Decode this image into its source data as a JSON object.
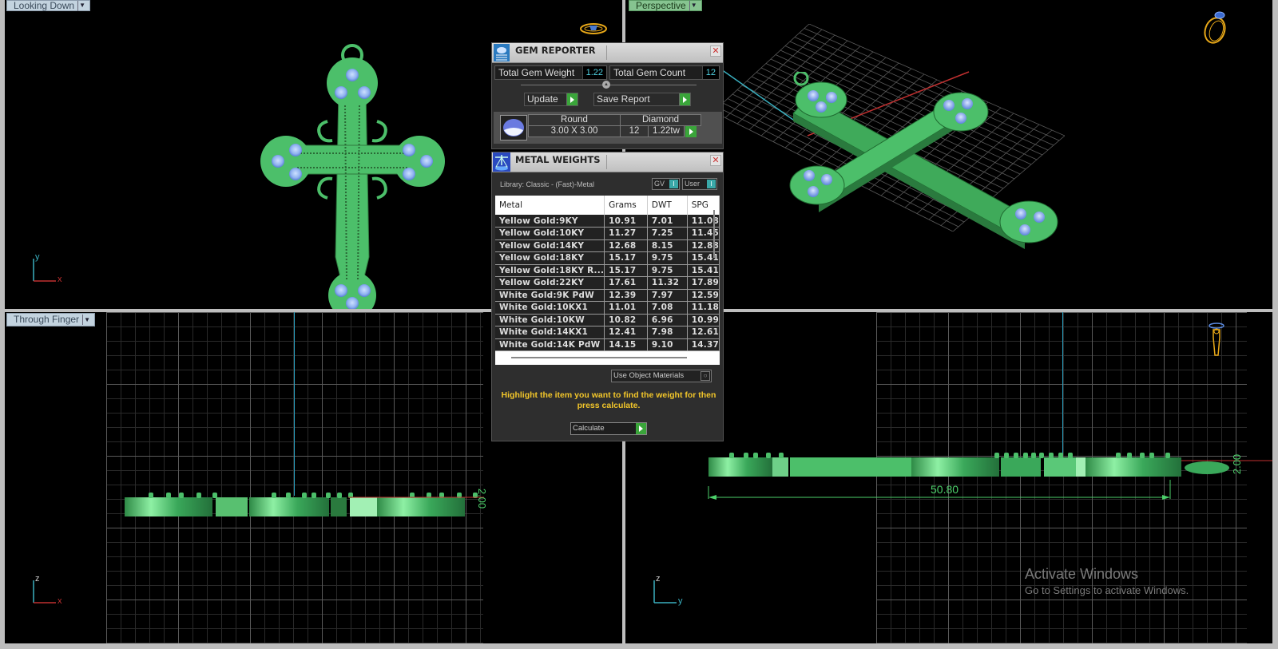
{
  "viewports": {
    "top_left": {
      "label": "Looking Down",
      "axis_v": "y",
      "axis_h": "x"
    },
    "top_right": {
      "label": "Perspective"
    },
    "bottom_left": {
      "label": "Through Finger",
      "axis_v": "z",
      "axis_h": "x",
      "dimension": "2.00"
    },
    "bottom_right": {
      "axis_v": "z",
      "axis_h": "y",
      "dimension_length": "50.80",
      "dimension_height": "2.00"
    }
  },
  "gem_reporter": {
    "title": "GEM REPORTER",
    "total_gem_weight_label": "Total Gem Weight",
    "total_gem_weight": "1.22",
    "total_gem_count_label": "Total Gem Count",
    "total_gem_count": "12",
    "update_label": "Update",
    "save_report_label": "Save Report",
    "gem": {
      "shape": "Round",
      "type": "Diamond",
      "size": "3.00 X 3.00",
      "count": "12",
      "weight": "1.22tw"
    }
  },
  "metal_weights": {
    "title": "METAL WEIGHTS",
    "library": "Library: Classic - (Fast)-Metal",
    "toggle_gv": "GV",
    "toggle_user": "User",
    "columns": [
      "Metal",
      "Grams",
      "DWT",
      "SPG"
    ],
    "rows": [
      {
        "metal": "Yellow Gold:9KY",
        "grams": "10.91",
        "dwt": "7.01",
        "spg": "11.08"
      },
      {
        "metal": "Yellow Gold:10KY",
        "grams": "11.27",
        "dwt": "7.25",
        "spg": "11.45"
      },
      {
        "metal": "Yellow Gold:14KY",
        "grams": "12.68",
        "dwt": "8.15",
        "spg": "12.88"
      },
      {
        "metal": "Yellow Gold:18KY",
        "grams": "15.17",
        "dwt": "9.75",
        "spg": "15.41"
      },
      {
        "metal": "Yellow Gold:18KY R...",
        "grams": "15.17",
        "dwt": "9.75",
        "spg": "15.41"
      },
      {
        "metal": "Yellow Gold:22KY",
        "grams": "17.61",
        "dwt": "11.32",
        "spg": "17.89"
      },
      {
        "metal": "White Gold:9K PdW",
        "grams": "12.39",
        "dwt": "7.97",
        "spg": "12.59"
      },
      {
        "metal": "White Gold:10KX1",
        "grams": "11.01",
        "dwt": "7.08",
        "spg": "11.18"
      },
      {
        "metal": "White Gold:10KW",
        "grams": "10.82",
        "dwt": "6.96",
        "spg": "10.99"
      },
      {
        "metal": "White Gold:14KX1",
        "grams": "12.41",
        "dwt": "7.98",
        "spg": "12.61"
      },
      {
        "metal": "White Gold:14K PdW",
        "grams": "14.15",
        "dwt": "9.10",
        "spg": "14.37"
      }
    ],
    "use_object_materials_label": "Use Object Materials",
    "hint": "Highlight the item you want to find the weight for then press calculate.",
    "calculate_label": "Calculate"
  },
  "watermark": {
    "title": "Activate Windows",
    "subtitle": "Go to Settings to activate Windows."
  },
  "colors": {
    "model_green": "#4cbf6a",
    "gem_blue": "#8fb2f0",
    "accent_cyan": "#4fd0e0",
    "hint_yellow": "#f2c62a",
    "go_green": "#3aa53a"
  }
}
